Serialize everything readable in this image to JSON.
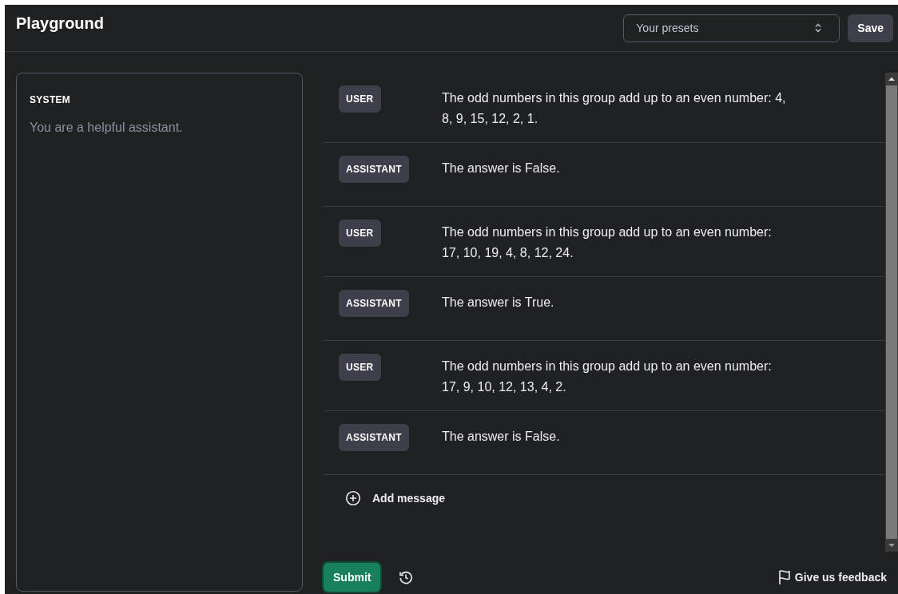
{
  "header": {
    "title": "Playground",
    "presets": {
      "value": "Your presets"
    },
    "save_button": "Save"
  },
  "system": {
    "label": "SYSTEM",
    "placeholder": "You are a helpful assistant."
  },
  "messages": [
    {
      "role": "USER",
      "text": "The odd numbers in this group add up to an even number: 4, 8, 9, 15, 12, 2, 1."
    },
    {
      "role": "ASSISTANT",
      "text": "The answer is False."
    },
    {
      "role": "USER",
      "text": "The odd numbers in this group add up to an even number: 17, 10, 19, 4, 8, 12, 24."
    },
    {
      "role": "ASSISTANT",
      "text": "The answer is True."
    },
    {
      "role": "USER",
      "text": "The odd numbers in this group add up to an even number: 17, 9, 10, 12, 13, 4, 2."
    },
    {
      "role": "ASSISTANT",
      "text": "The answer is False."
    }
  ],
  "add_message": "Add message",
  "footer": {
    "submit": "Submit",
    "feedback": "Give us feedback"
  }
}
